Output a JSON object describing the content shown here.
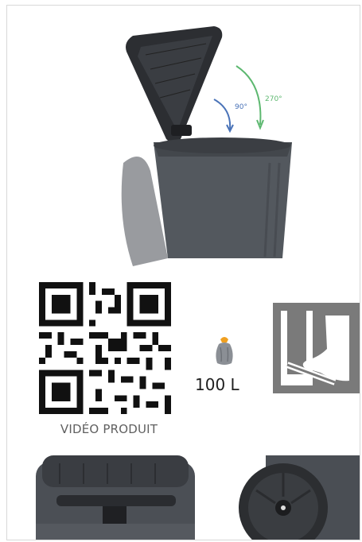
{
  "qr": {
    "label": "VIDÉO PRODUIT"
  },
  "capacity": {
    "value": "100 L"
  },
  "icons": {
    "bag": "garbage-bag-icon",
    "pedal": "foot-pedal-icon"
  },
  "colors": {
    "bin": "#53585e",
    "lid": "#2d2f33",
    "arrow_green": "#5db870",
    "arrow_blue": "#4a73b8",
    "pedal_icon": "#7a7a7a",
    "bag_accent": "#f0a020"
  }
}
